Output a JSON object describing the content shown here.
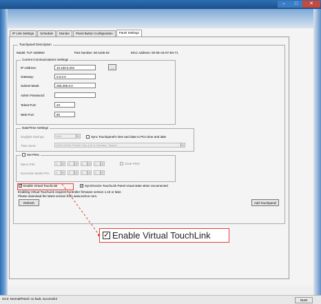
{
  "window": {
    "minimize_glyph": "–",
    "maximize_glyph": "□",
    "close_glyph": "✕"
  },
  "tabs": [
    {
      "label": "IP Link Settings"
    },
    {
      "label": "Schedule"
    },
    {
      "label": "Monitor"
    },
    {
      "label": "Panel Button Configuration"
    },
    {
      "label": "Panel Settings"
    }
  ],
  "touchpanel_desc": {
    "legend": "Touchpanel Description",
    "model": "Model: TLP 1000MV",
    "part_number": "Part Number: 60-1105-02",
    "mac_address": "MAC Address: 00-05-A6-07-E0-71"
  },
  "comm": {
    "legend": "Current Communications Settings",
    "ip_label": "IP Address:",
    "ip_value": "10.100.5.201",
    "browse_label": "...",
    "gateway_label": "Gateway:",
    "gateway_value": "0.0.0.0",
    "subnet_label": "Subnet Mask:",
    "subnet_value": "255.255.0.0",
    "admin_label": "Admin Password:",
    "admin_value": "",
    "telnet_label": "Telnet Port:",
    "telnet_value": "23",
    "web_label": "Web Port:",
    "web_value": "80"
  },
  "datetime": {
    "legend": "Date/Time Settings",
    "dst_label": "Daylight Savings:",
    "dst_value": "USA",
    "sync_label": "Sync Touchpanel's time and date to PCs time and date",
    "tz_label": "Time Zone:",
    "tz_value": "(GMT-08:00) Pacific Time (US & Canada), Tijuana"
  },
  "pins": {
    "legend": "Set PINs",
    "menu_label": "Menu PIN:",
    "exec_label": "Executive Mode PIN:",
    "clear_label": "Clear PINs",
    "digit": "0"
  },
  "options": {
    "enable_vtl_label": "Enable Virtual TouchLink",
    "sync_vtl_label": "Synchronize TouchLink Panel visual state when reconnected",
    "note_line1": "Enabling Virtual TouchLink requires controller firmware version 1.16 or later.",
    "note_line2": "Please download the latest version from www.extron.com."
  },
  "buttons": {
    "refresh": "Refresh",
    "add_touchpanel": "Add Touchpanel"
  },
  "status": {
    "text": "GC3: Normal/Panel: no fault, successful",
    "mode": "NUM"
  },
  "callout": {
    "check": "✓",
    "label": "Enable Virtual TouchLink"
  },
  "colors": {
    "highlight": "#e63a3a",
    "titlebar": "#1c4f8a"
  }
}
